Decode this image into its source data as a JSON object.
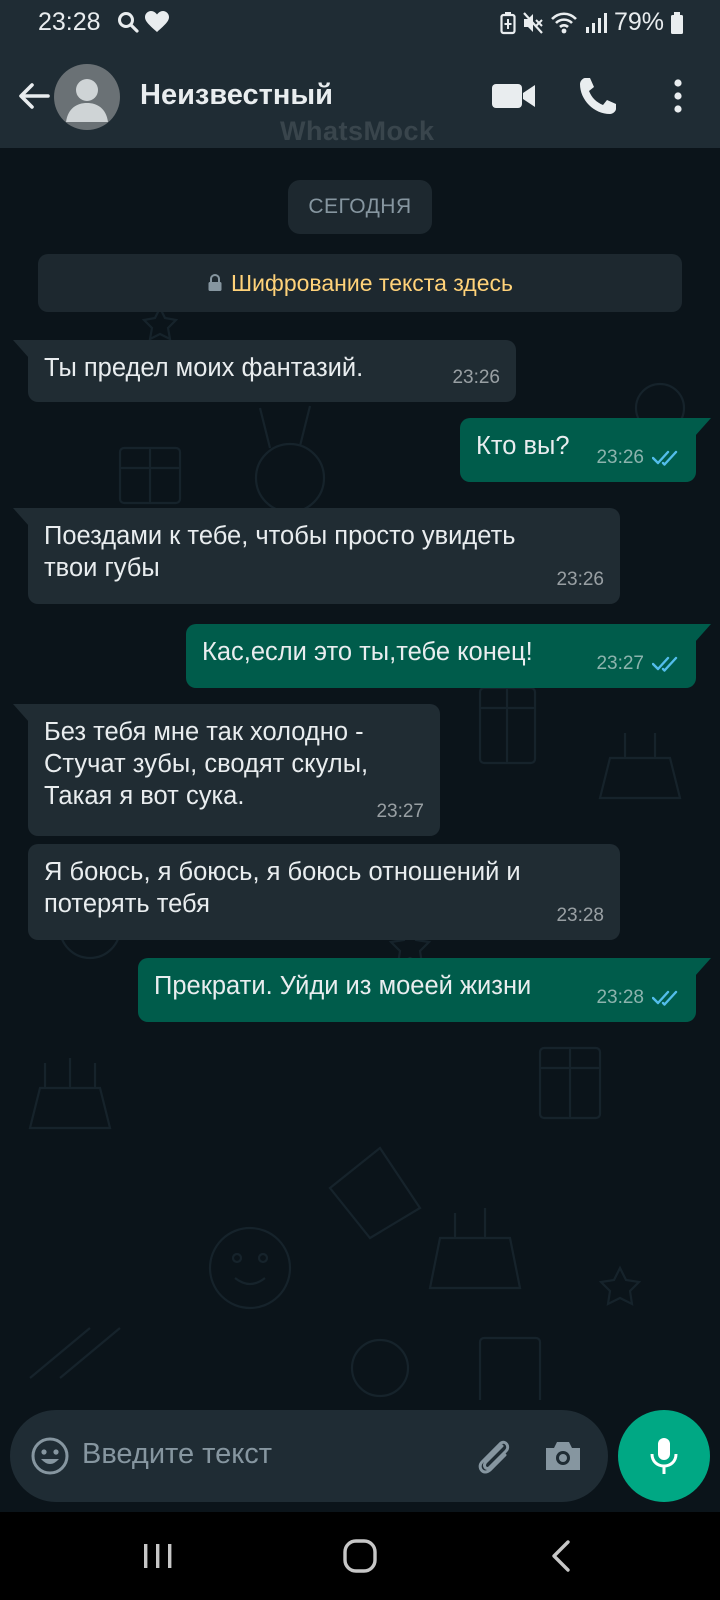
{
  "status_bar": {
    "time": "23:28",
    "battery_percent": "79%",
    "icons": [
      "search-icon",
      "heart-icon",
      "battery-saver-icon",
      "mute-icon",
      "wifi-icon",
      "signal-icon",
      "battery-icon"
    ]
  },
  "header": {
    "contact_name": "Неизвестный",
    "watermark": "WhatsMock",
    "icons": [
      "back-arrow-icon",
      "avatar-icon",
      "video-call-icon",
      "phone-icon",
      "more-vert-icon"
    ]
  },
  "chat": {
    "date_label": "СЕГОДНЯ",
    "encryption_notice": "Шифрование текста здесь",
    "messages": [
      {
        "direction": "in",
        "text": "Ты предел моих фантазий.",
        "time": "23:26"
      },
      {
        "direction": "out",
        "text": "Кто вы?",
        "time": "23:26",
        "read": true
      },
      {
        "direction": "in",
        "text": "Поездами к тебе, чтобы просто увидеть\nтвои губы",
        "time": "23:26"
      },
      {
        "direction": "out",
        "text": "Кас,если это ты,тебе конец!",
        "time": "23:27",
        "read": true
      },
      {
        "direction": "in",
        "text": "Без тебя мне так холодно -\nСтучат зубы, сводят скулы,\nТакая я вот сука.",
        "time": "23:27"
      },
      {
        "direction": "in",
        "text": "Я боюсь, я боюсь, я боюсь отношений и\nпотерять тебя",
        "time": "23:28"
      },
      {
        "direction": "out",
        "text": "Прекрати. Уйди из моеей жизни",
        "time": "23:28",
        "read": true
      }
    ]
  },
  "composer": {
    "placeholder": "Введите текст",
    "icons": [
      "emoji-icon",
      "attach-icon",
      "camera-icon",
      "microphone-icon"
    ]
  },
  "colors": {
    "background": "#0b141a",
    "header": "#1f2c34",
    "incoming_bubble": "#202c33",
    "outgoing_bubble": "#005c4b",
    "read_ticks": "#53bdeb",
    "encryption_text": "#ffd279",
    "mic_button": "#00a884"
  }
}
